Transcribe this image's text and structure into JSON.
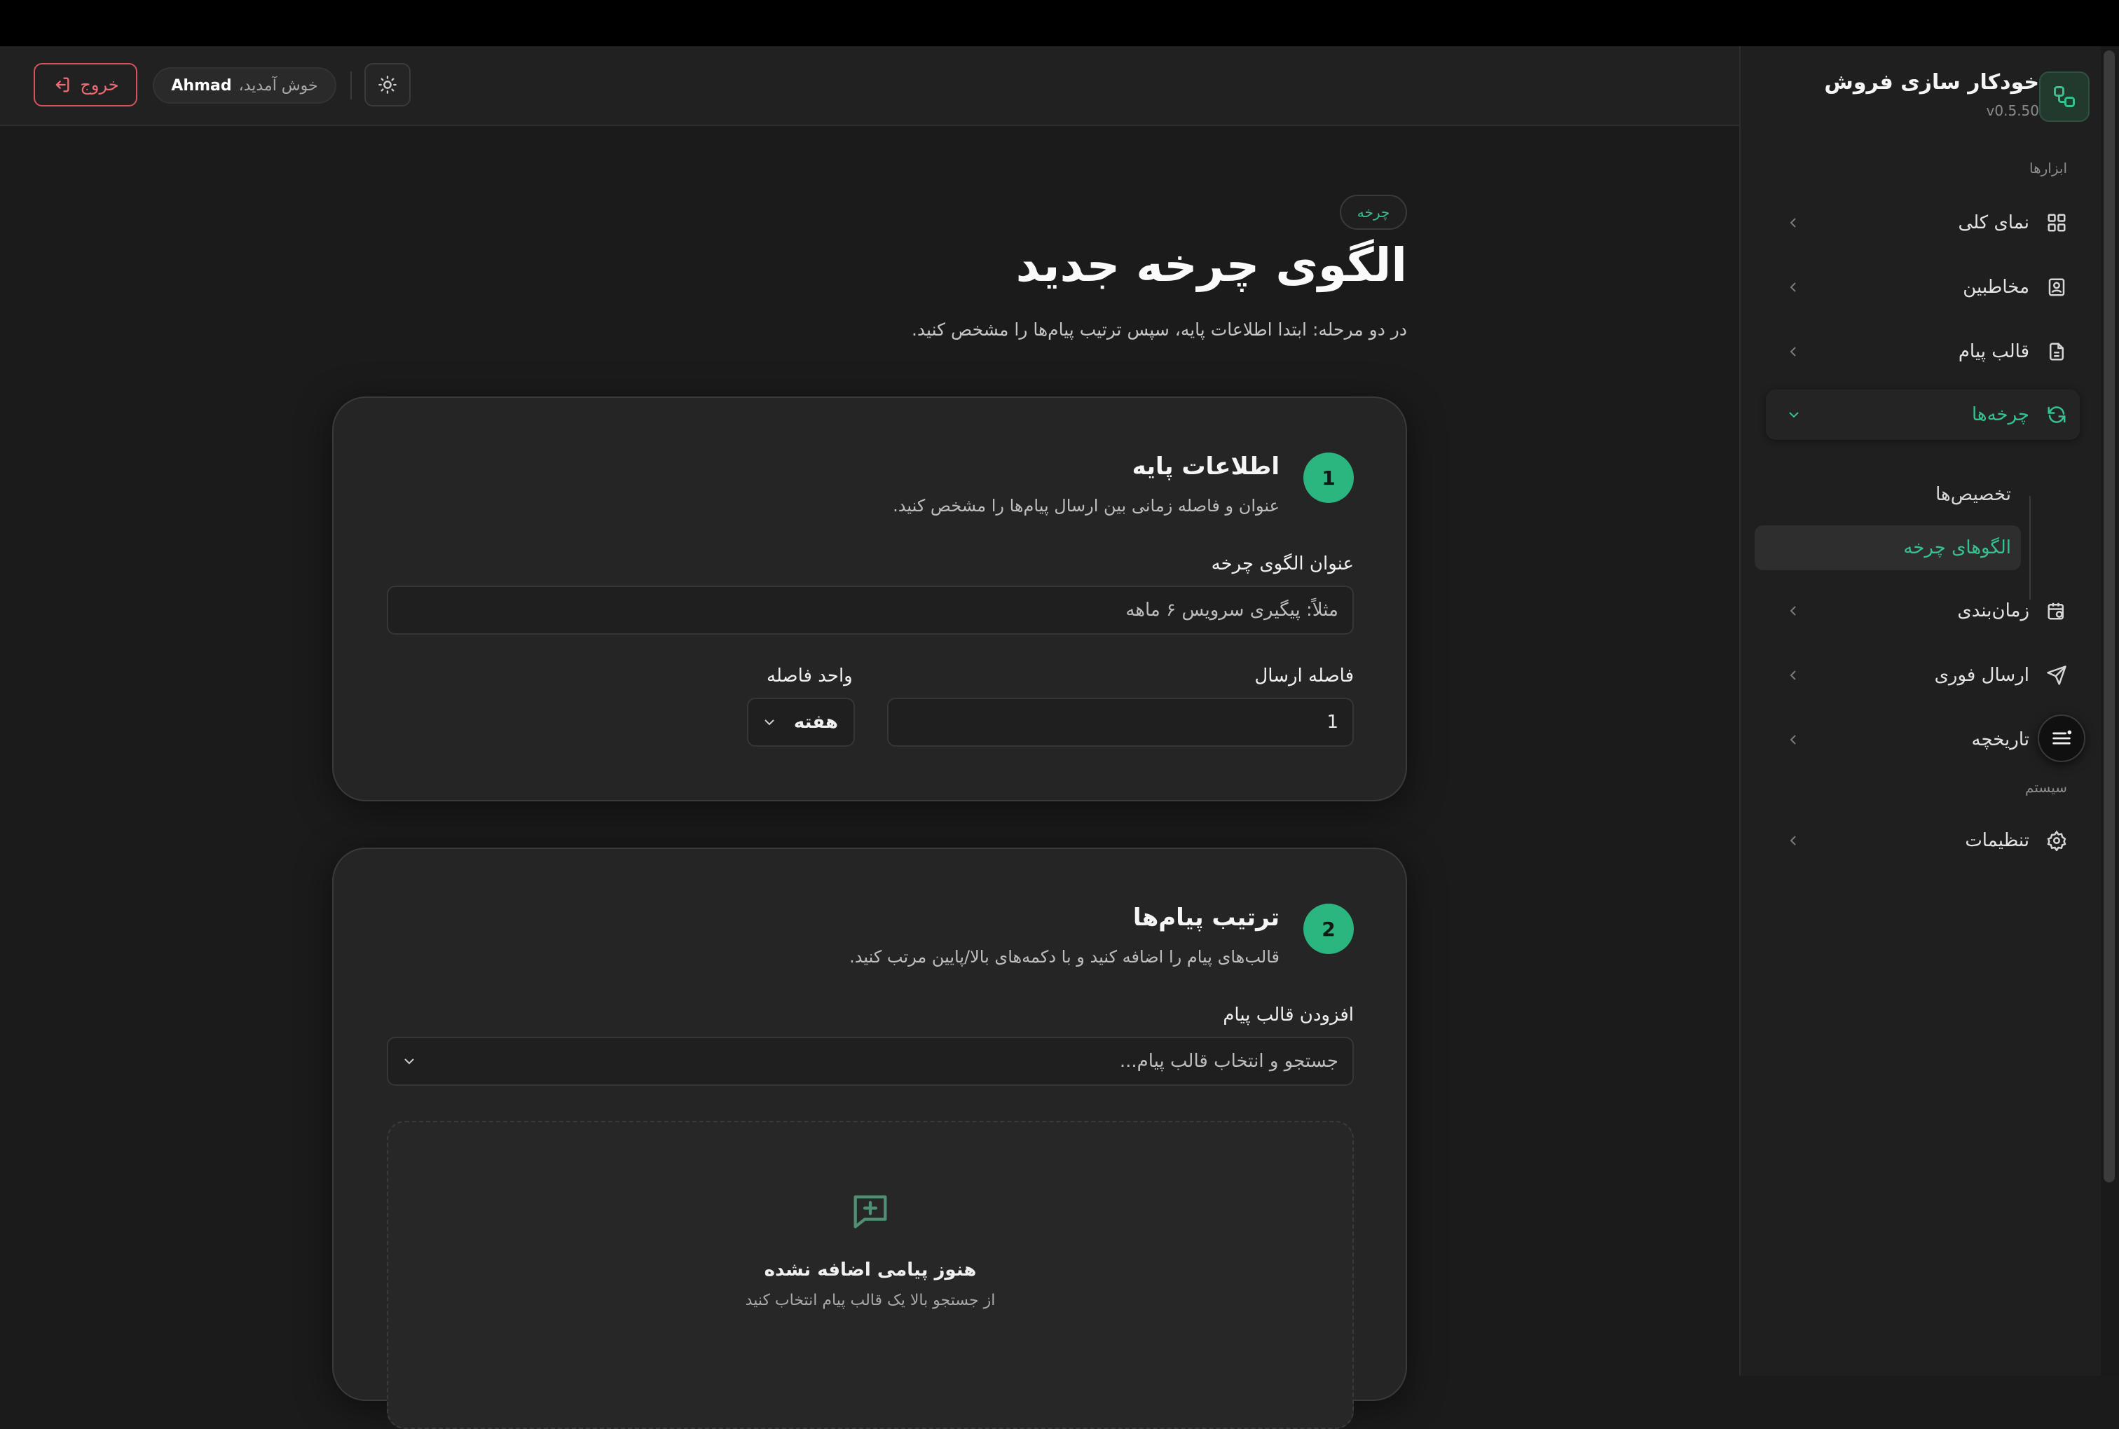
{
  "header": {
    "logout_label": "خروج",
    "welcome_text": "خوش آمدید،",
    "username": "Ahmad"
  },
  "sidebar": {
    "brand_title": "خودکار سازی فروش",
    "version": "v0.5.50",
    "tools_section": "ابزارها",
    "system_section": "سیستم",
    "items": [
      {
        "label": "نمای کلی",
        "icon": "dashboard-icon"
      },
      {
        "label": "مخاطبین",
        "icon": "contacts-icon"
      },
      {
        "label": "قالب پیام",
        "icon": "document-icon"
      },
      {
        "label": "چرخه‌ها",
        "icon": "refresh-icon"
      },
      {
        "label": "زمان‌بندی",
        "icon": "calendar-clock-icon"
      },
      {
        "label": "ارسال فوری",
        "icon": "send-icon"
      },
      {
        "label": "تاریخچه",
        "icon": "history-icon"
      },
      {
        "label": "تنظیمات",
        "icon": "gear-icon"
      }
    ],
    "subitems": [
      {
        "label": "تخصیص‌ها"
      },
      {
        "label": "الگوهای چرخه"
      }
    ]
  },
  "main": {
    "badge": "چرخه",
    "title": "الگوی چرخه جدید",
    "subtitle": "در دو مرحله: ابتدا اطلاعات پایه، سپس ترتیب پیام‌ها را مشخص کنید.",
    "step1": {
      "number": "1",
      "title": "اطلاعات پایه",
      "description": "عنوان و فاصله زمانی بین ارسال پیام‌ها را مشخص کنید.",
      "name_label": "عنوان الگوی چرخه",
      "name_placeholder": "مثلاً: پیگیری سرویس ۶ ماهه",
      "interval_label": "فاصله ارسال",
      "interval_value": "1",
      "unit_label": "واحد فاصله",
      "unit_value": "هفته"
    },
    "step2": {
      "number": "2",
      "title": "ترتیب پیام‌ها",
      "description": "قالب‌های پیام را اضافه کنید و با دکمه‌های بالا/پایین مرتب کنید.",
      "add_label": "افزودن قالب پیام",
      "add_placeholder": "جستجو و انتخاب قالب پیام...",
      "empty_title": "هنوز پیامی اضافه نشده",
      "empty_subtitle": "از جستجو بالا یک قالب پیام انتخاب کنید"
    }
  },
  "colors": {
    "accent": "#34c38f",
    "danger": "#ef6b74",
    "background": "#1b1b1b"
  }
}
